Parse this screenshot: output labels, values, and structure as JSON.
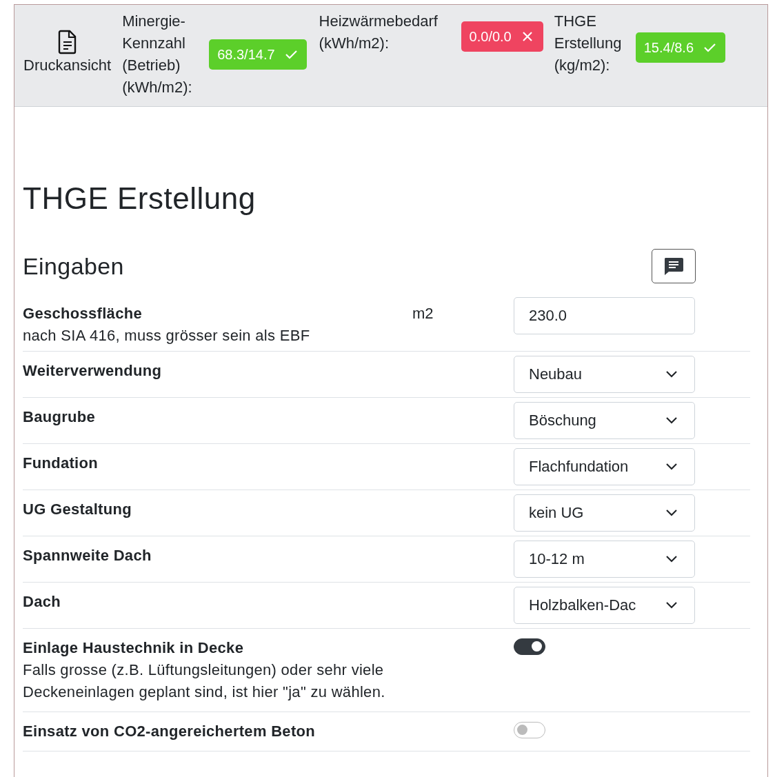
{
  "header": {
    "print_button": "Druckansicht",
    "metrics": [
      {
        "label": "Minergie-Kennzahl (Betrieb) (kWh/m2):",
        "value": "68.3/14.7",
        "passed": true
      },
      {
        "label": "Heizwärmebedarf (kWh/m2):",
        "value": "0.0/0.0",
        "passed": false
      },
      {
        "label": "THGE Erstellung (kg/m2):",
        "value": "15.4/8.6",
        "passed": true
      }
    ]
  },
  "title": "THGE Erstellung",
  "section": "Eingaben",
  "rows": [
    {
      "kind": "number",
      "label": "Geschossfläche",
      "hint": "nach SIA 416, muss grösser sein als EBF",
      "unit": "m2",
      "value": "230.0"
    },
    {
      "kind": "select",
      "label": "Weiterverwendung",
      "value": "Neubau"
    },
    {
      "kind": "select",
      "label": "Baugrube",
      "value": "Böschung"
    },
    {
      "kind": "select",
      "label": "Fundation",
      "value": "Flachfundation"
    },
    {
      "kind": "select",
      "label": "UG Gestaltung",
      "value": "kein UG"
    },
    {
      "kind": "select",
      "label": "Spannweite Dach",
      "value": "10-12 m"
    },
    {
      "kind": "select",
      "label": "Dach",
      "value": "Holzbalken-Dac"
    },
    {
      "kind": "toggle",
      "label": "Einlage Haustechnik in Decke",
      "hint": "Falls grosse (z.B. Lüftungsleitungen) oder sehr viele Deckeneinlagen geplant sind, ist hier \"ja\" zu wählen.",
      "on": true
    },
    {
      "kind": "toggle",
      "label": "Einsatz von CO2-angereichertem Beton",
      "on": false
    }
  ]
}
